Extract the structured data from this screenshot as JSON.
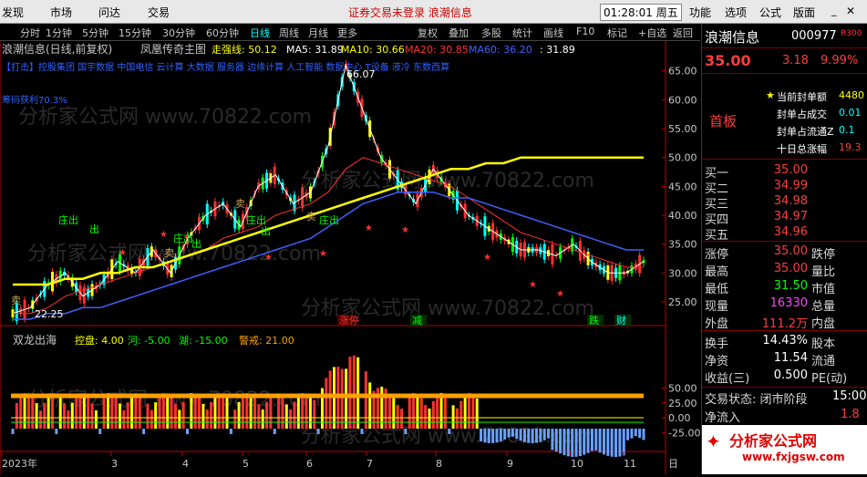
{
  "menu": [
    "发现",
    "市场",
    "问达",
    "交易"
  ],
  "menu_right": [
    "功能",
    "选项",
    "公式",
    "版面"
  ],
  "menu_notice": "证券交易未登录 浪潮信息",
  "clock": "01:28:01 周五",
  "toolbar": {
    "periods": [
      "分时",
      "1分钟",
      "5分钟",
      "15分钟",
      "30分钟",
      "60分钟",
      "日线",
      "周线",
      "月线",
      "更多"
    ],
    "tools": [
      "复权",
      "叠加",
      "多股",
      "统计",
      "画线",
      "F10",
      "标记",
      "+自选",
      "返回"
    ]
  },
  "main_panel": {
    "title": "浪潮信息(日线,前复权)",
    "indicator": "凤凰传奇主图",
    "legend": [
      {
        "label": "走强线: 50.12",
        "color": "#ffff00"
      },
      {
        "label": "MA5: 31.89",
        "color": "#ffffff"
      },
      {
        "label": "MA10: 30.66",
        "color": "#ffff00"
      },
      {
        "label": "MA20: 30.85",
        "color": "#ff3030"
      },
      {
        "label": "MA60: 36.20",
        "color": "#4060ff"
      },
      {
        "label": ": 31.89",
        "color": "#ffffff"
      }
    ],
    "ticker_text": "【打击】控股集团 国宇数据 中国电信 云计算 大数据 服务器 边缘计算 人工智能 数据中心 T设备 液冷 东数西算",
    "left_note": "筹码获利70.3%",
    "high_label": "66.07",
    "low_label": "22.25",
    "signal_texts": [
      "卖",
      "庄出",
      "出",
      "卖",
      "庄出",
      "出",
      "卖",
      "庄出",
      "出",
      "卖",
      "庄出"
    ],
    "bottom_tags": [
      {
        "text": "涨停",
        "color": "#ff3030"
      },
      {
        "text": "减",
        "color": "#00ff00"
      },
      {
        "text": "跌",
        "color": "#00ff00"
      },
      {
        "text": "财",
        "color": "#00ffff"
      }
    ],
    "y_ticks": [
      "65.00",
      "60.00",
      "55.00",
      "50.00",
      "45.00",
      "40.00",
      "35.00",
      "30.00",
      "25.00"
    ]
  },
  "sub_panel": {
    "title": "双龙出海",
    "legend": [
      {
        "label": "控盘: 4.00",
        "color": "#ffff00"
      },
      {
        "label": "河: -5.00",
        "color": "#00ff00"
      },
      {
        "label": "湖: -15.00",
        "color": "#00ff00"
      },
      {
        "label": "警戒: 21.00",
        "color": "#ffa000"
      }
    ],
    "y_ticks": [
      "50.00",
      "25.00",
      "0.00",
      "-25.00"
    ]
  },
  "x_axis": [
    "2023年",
    "3",
    "4",
    "5",
    "6",
    "7",
    "8",
    "9",
    "10",
    "11",
    "日"
  ],
  "watermark": "分析家公式网 www.70822.com",
  "quote": {
    "name": "浪潮信息",
    "code": "000977",
    "badge": "R300",
    "price": "35.00",
    "change": "3.18",
    "pct": "9.99%",
    "seal_rows": [
      {
        "label": "当前封单额",
        "value": "4480"
      },
      {
        "label": "封单占成交",
        "value": "0.01"
      },
      {
        "label": "封单占流通Z",
        "value": "0.1"
      },
      {
        "label": "十日总涨幅",
        "value": "19.3"
      }
    ],
    "board": "首板",
    "asks": [
      {
        "label": "买一",
        "price": "35.00"
      },
      {
        "label": "买二",
        "price": "34.99"
      },
      {
        "label": "买三",
        "price": "34.98"
      },
      {
        "label": "买四",
        "price": "34.97"
      },
      {
        "label": "买五",
        "price": "34.96"
      }
    ],
    "stats": [
      {
        "l": "涨停",
        "v": "35.00",
        "c": "#ff3c3c",
        "r": "跌停"
      },
      {
        "l": "最高",
        "v": "35.00",
        "c": "#ff3c3c",
        "r": "量比"
      },
      {
        "l": "最低",
        "v": "31.50",
        "c": "#00ff00",
        "r": "市值"
      },
      {
        "l": "现量",
        "v": "16330",
        "c": "#ff40ff",
        "r": "总量"
      },
      {
        "l": "外盘",
        "v": "111.2万",
        "c": "#ff3c3c",
        "r": "内盘"
      }
    ],
    "stats2": [
      {
        "l": "换手",
        "v": "14.43%",
        "c": "#ffffff",
        "r": "股本"
      },
      {
        "l": "净资",
        "v": "11.54",
        "c": "#ffffff",
        "r": "流通"
      },
      {
        "l": "收益(三)",
        "v": "0.500",
        "c": "#ffffff",
        "r": "PE(动)"
      }
    ],
    "status": "交易状态: 闭市阶段",
    "status_time": "15:00",
    "net_inflow_label": "净流入",
    "net_inflow_value": "1.8"
  },
  "logo": {
    "name": "分析家公式网",
    "url": "www.fxjgsw.com"
  },
  "colors": {
    "up": "#ff3030",
    "down": "#00ffff",
    "ma5": "#ffffff",
    "ma10": "#ffff00",
    "ma20": "#ff3030",
    "ma60": "#4060ff",
    "strong": "#ffff00",
    "alert": "#ffa000"
  },
  "chart_data": {
    "type": "line",
    "ylim": [
      22,
      67
    ],
    "series": [
      {
        "name": "MA5",
        "values": [
          23,
          24,
          28,
          30,
          26,
          28,
          32,
          30,
          34,
          30,
          36,
          40,
          42,
          38,
          45,
          47,
          42,
          44,
          52,
          66,
          58,
          50,
          46,
          42,
          48,
          44,
          40,
          38,
          36,
          34,
          34,
          33,
          35,
          32,
          30,
          30,
          32
        ]
      },
      {
        "name": "MA20",
        "values": [
          23,
          23,
          24,
          26,
          27,
          28,
          29,
          30,
          31,
          32,
          33,
          34,
          36,
          37,
          38,
          40,
          41,
          42,
          44,
          48,
          50,
          49,
          48,
          47,
          46,
          45,
          43,
          41,
          39,
          37,
          36,
          35,
          34,
          33,
          32,
          31,
          31
        ]
      },
      {
        "name": "MA60",
        "values": [
          22,
          22,
          23,
          23,
          24,
          24,
          25,
          26,
          27,
          28,
          29,
          30,
          31,
          32,
          33,
          34,
          35,
          36,
          38,
          40,
          42,
          43,
          44,
          44,
          44,
          43,
          43,
          42,
          41,
          40,
          39,
          38,
          37,
          36,
          35,
          34,
          34
        ]
      },
      {
        "name": "走强线",
        "values": [
          28,
          28,
          28,
          29,
          29,
          30,
          30,
          31,
          31,
          32,
          33,
          34,
          35,
          36,
          37,
          38,
          39,
          40,
          41,
          42,
          43,
          44,
          45,
          46,
          47,
          48,
          48,
          49,
          49,
          50,
          50,
          50,
          50,
          50,
          50,
          50,
          50
        ]
      }
    ]
  }
}
